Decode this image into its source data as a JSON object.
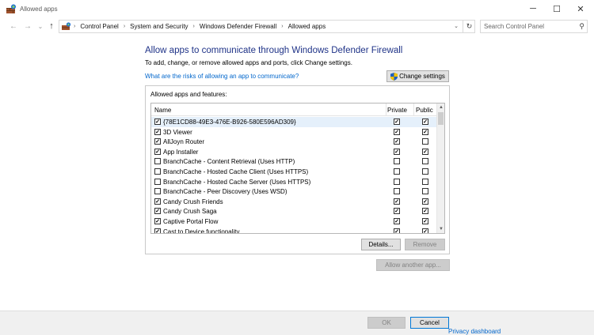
{
  "window": {
    "title": "Allowed apps",
    "minimize_glyph": "─",
    "maximize_glyph": "☐",
    "close_glyph": "✕"
  },
  "nav": {
    "back_glyph": "←",
    "forward_glyph": "→",
    "recent_glyph": "⌄",
    "up_glyph": "↑",
    "dropdown_glyph": "⌄",
    "refresh_glyph": "↻",
    "separator_glyph": "›",
    "breadcrumbs": [
      "Control Panel",
      "System and Security",
      "Windows Defender Firewall",
      "Allowed apps"
    ],
    "search_placeholder": "Search Control Panel",
    "search_glyph": "⚲"
  },
  "main": {
    "heading": "Allow apps to communicate through Windows Defender Firewall",
    "subtext": "To add, change, or remove allowed apps and ports, click Change settings.",
    "risk_link": "What are the risks of allowing an app to communicate?",
    "change_settings_label": "Change settings"
  },
  "apps_group": {
    "label": "Allowed apps and features:",
    "columns": {
      "name": "Name",
      "private": "Private",
      "public": "Public"
    },
    "items": [
      {
        "name": "{78E1CD88-49E3-476E-B926-580E596AD309}",
        "enabled": true,
        "private": true,
        "public": true,
        "selected": true
      },
      {
        "name": "3D Viewer",
        "enabled": true,
        "private": true,
        "public": true,
        "selected": false
      },
      {
        "name": "AllJoyn Router",
        "enabled": true,
        "private": true,
        "public": false,
        "selected": false
      },
      {
        "name": "App Installer",
        "enabled": true,
        "private": true,
        "public": true,
        "selected": false
      },
      {
        "name": "BranchCache - Content Retrieval (Uses HTTP)",
        "enabled": false,
        "private": false,
        "public": false,
        "selected": false
      },
      {
        "name": "BranchCache - Hosted Cache Client (Uses HTTPS)",
        "enabled": false,
        "private": false,
        "public": false,
        "selected": false
      },
      {
        "name": "BranchCache - Hosted Cache Server (Uses HTTPS)",
        "enabled": false,
        "private": false,
        "public": false,
        "selected": false
      },
      {
        "name": "BranchCache - Peer Discovery (Uses WSD)",
        "enabled": false,
        "private": false,
        "public": false,
        "selected": false
      },
      {
        "name": "Candy Crush Friends",
        "enabled": true,
        "private": true,
        "public": true,
        "selected": false
      },
      {
        "name": "Candy Crush Saga",
        "enabled": true,
        "private": true,
        "public": true,
        "selected": false
      },
      {
        "name": "Captive Portal Flow",
        "enabled": true,
        "private": true,
        "public": true,
        "selected": false
      },
      {
        "name": "Cast to Device functionality",
        "enabled": true,
        "private": true,
        "public": true,
        "selected": false
      }
    ],
    "scroll_up_glyph": "▲",
    "scroll_down_glyph": "▼",
    "details_label": "Details...",
    "remove_label": "Remove"
  },
  "allow_another_label": "Allow another app...",
  "footer": {
    "ok_label": "OK",
    "cancel_label": "Cancel",
    "peek_text": "Privacy dashboard"
  },
  "colors": {
    "heading": "#1e3287",
    "link": "#0066cc",
    "selected_row": "#e5f0fb",
    "footer_bg": "#f0f0f0"
  }
}
